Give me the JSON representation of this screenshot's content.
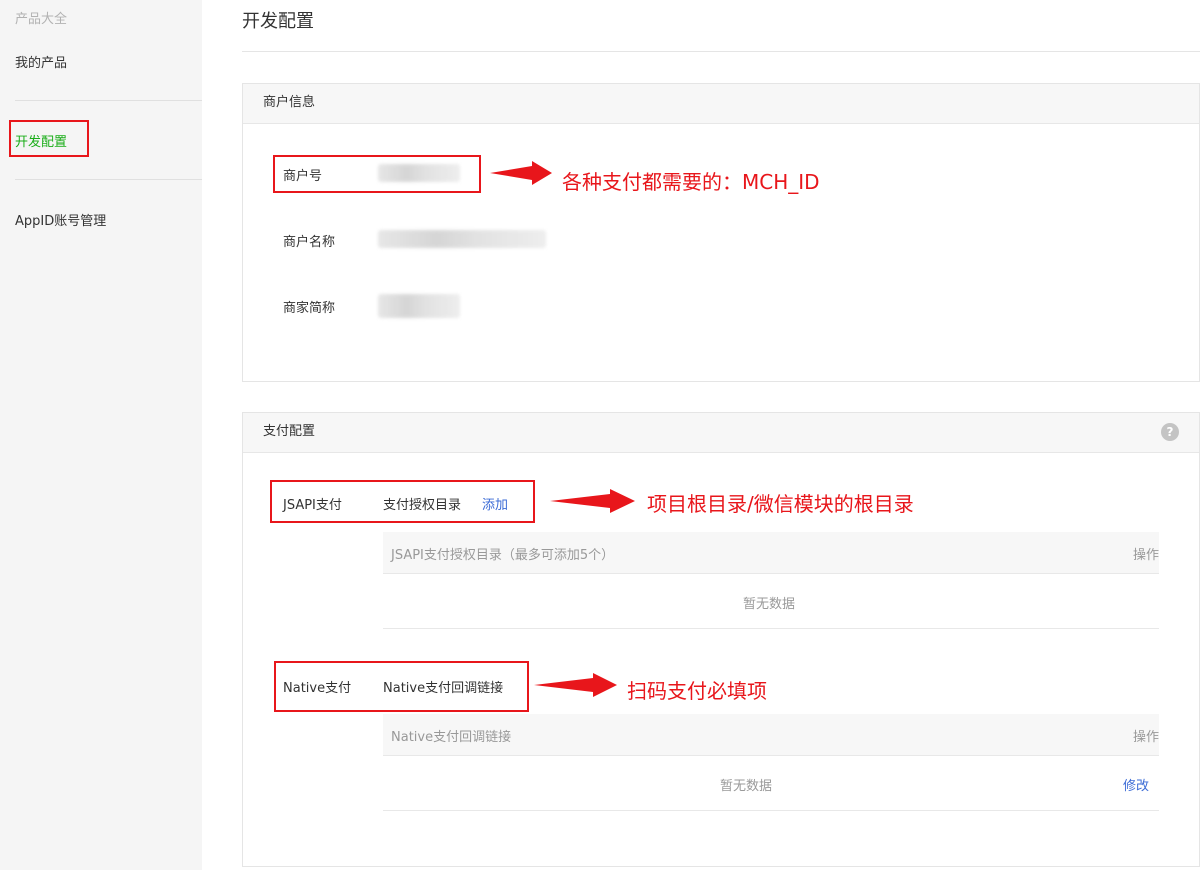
{
  "sidebar": {
    "items": [
      {
        "label": "产品大全"
      },
      {
        "label": "我的产品"
      },
      {
        "label": "开发配置"
      },
      {
        "label": "AppID账号管理"
      }
    ]
  },
  "page": {
    "title": "开发配置"
  },
  "merchant_panel": {
    "title": "商户信息",
    "fields": [
      {
        "label": "商户号"
      },
      {
        "label": "商户名称"
      },
      {
        "label": "商家简称"
      }
    ]
  },
  "pay_panel": {
    "title": "支付配置",
    "help_icon": "?",
    "jsapi": {
      "label": "JSAPI支付",
      "dir_label": "支付授权目录",
      "add_link": "添加",
      "table": {
        "col1": "JSAPI支付授权目录（最多可添加5个）",
        "col2": "操作",
        "empty": "暂无数据"
      }
    },
    "native": {
      "label": "Native支付",
      "callback_label": "Native支付回调链接",
      "table": {
        "col1": "Native支付回调链接",
        "col2": "操作",
        "empty": "暂无数据",
        "edit": "修改"
      }
    }
  },
  "annotations": {
    "mch_id": "各种支付都需要的：MCH_ID",
    "jsapi_dir": "项目根目录/微信模块的根目录",
    "native_required": "扫码支付必填项"
  },
  "colors": {
    "active_green": "#1aad19",
    "annotation_red": "#e8161b",
    "link_blue": "#3b6bd6"
  }
}
